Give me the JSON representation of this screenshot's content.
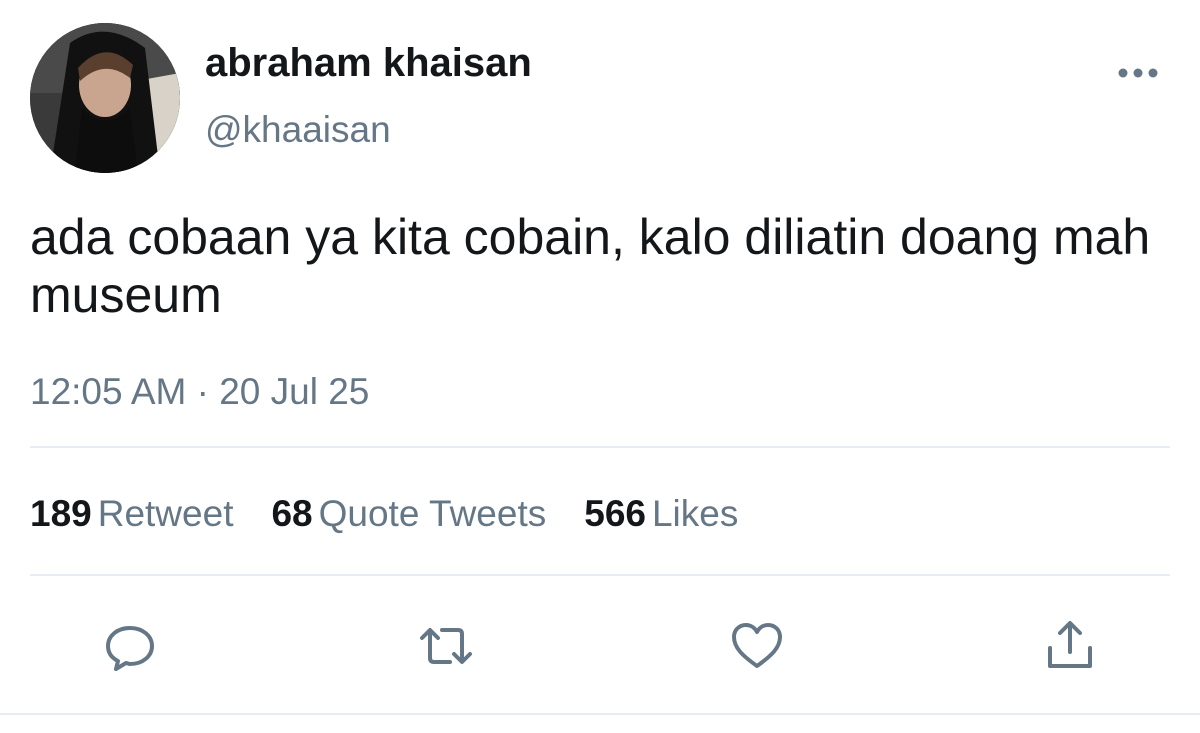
{
  "author": {
    "display_name": "abraham khaisan",
    "username": "@khaaisan"
  },
  "tweet": {
    "text": "ada cobaan ya kita cobain, kalo diliatin doang mah museum",
    "timestamp": "12:05 AM · 20 Jul 25"
  },
  "stats": {
    "retweets": {
      "count": "189",
      "label": "Retweet"
    },
    "quote_tweets": {
      "count": "68",
      "label": "Quote Tweets"
    },
    "likes": {
      "count": "566",
      "label": "Likes"
    }
  },
  "actions": {
    "reply_icon": "comment-icon",
    "retweet_icon": "retweet-icon",
    "like_icon": "heart-icon",
    "share_icon": "share-icon",
    "more_icon": "ellipsis-icon"
  },
  "colors": {
    "primary_text": "#14171a",
    "secondary_text": "#657786",
    "icon": "#657786",
    "divider": "#e6ecf0"
  }
}
